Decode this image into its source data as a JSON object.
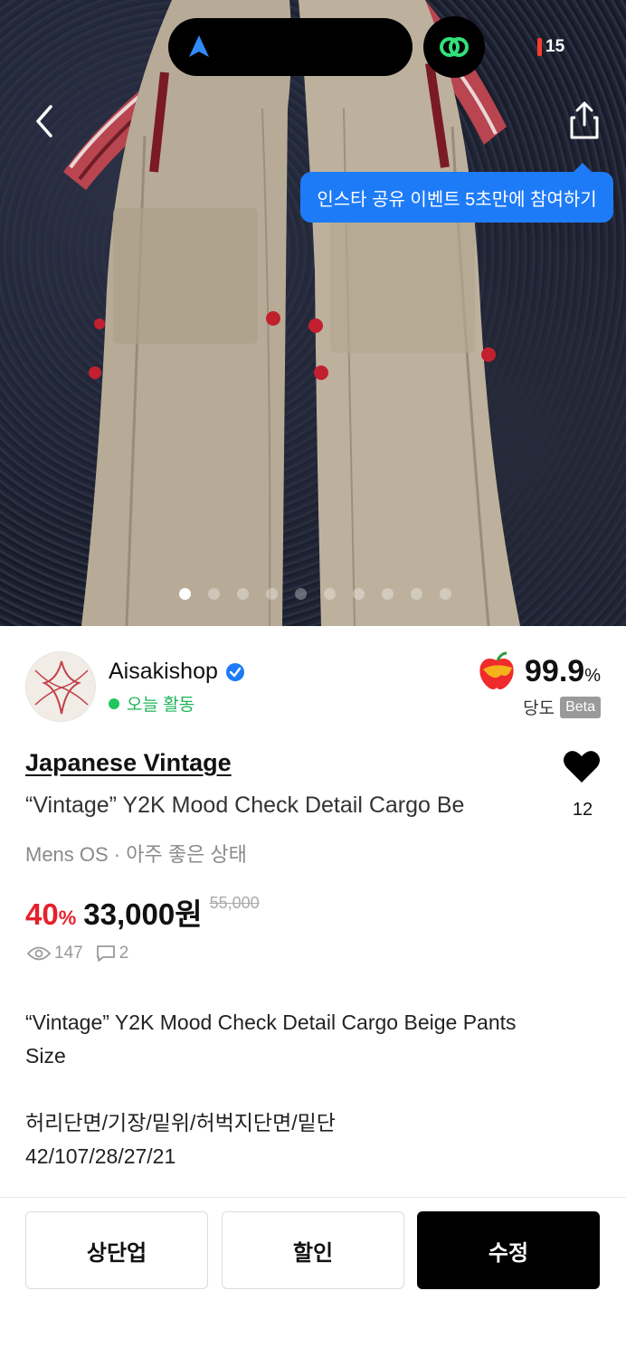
{
  "app": {
    "battery_level": "15"
  },
  "hero": {
    "tooltip": "인스타 공유 이벤트 5초만에 참여하기",
    "image_count": 10,
    "active_index": 0
  },
  "seller": {
    "name": "Aisakishop",
    "activity": "오늘 활동",
    "score": "99.9",
    "score_unit": "%",
    "score_label": "당도",
    "beta": "Beta"
  },
  "product": {
    "brand": "Japanese Vintage",
    "title": "“Vintage” Y2K Mood Check Detail Cargo Be",
    "meta": "Mens OS · 아주 좋은 상태",
    "likes": "12",
    "discount_value": "40",
    "discount_unit": "%",
    "price": "33,000원",
    "original_price": "55,000",
    "views": "147",
    "comments": "2"
  },
  "description": [
    "“Vintage” Y2K Mood Check Detail Cargo Beige Pants",
    "Size",
    "",
    "허리단면/기장/밑위/허벅지단면/밑단",
    "42/107/28/27/21"
  ],
  "actions": {
    "bump": "상단업",
    "discount": "할인",
    "edit": "수정"
  },
  "colors": {
    "accent_blue": "#1e7bf7",
    "discount_red": "#e5202c",
    "active_green": "#22c55e"
  }
}
